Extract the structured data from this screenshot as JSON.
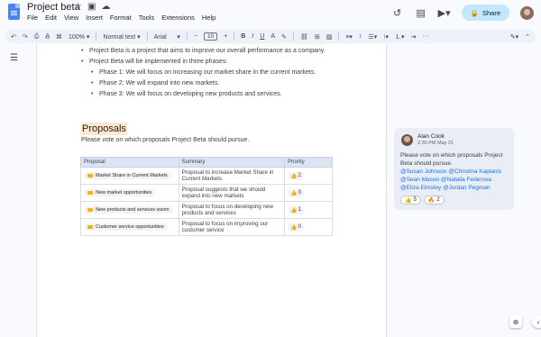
{
  "app": {
    "title": "Project beta",
    "menu": [
      "File",
      "Edit",
      "View",
      "Insert",
      "Format",
      "Tools",
      "Extensions",
      "Help"
    ],
    "share_label": "Share"
  },
  "toolbar": {
    "zoom": "100%",
    "style": "Normal text",
    "font": "Arial",
    "font_size": "10",
    "more": "···"
  },
  "document": {
    "bullets": [
      "Project Beta is a project that aims to improve our overall performance as a company.",
      "Project Beta will be implemented in three phases:"
    ],
    "sub_bullets": [
      "Phase 1: We will focus on increasing our market share in the current markets.",
      "Phase 2: We will expand into new markets.",
      "Phase 3: We will focus on developing new products and services."
    ],
    "heading": "Proposals",
    "subtitle": "Please vote on which proposals Project Beta should pursue.",
    "table": {
      "headers": [
        "Proposal",
        "Summary",
        "Priority"
      ],
      "rows": [
        {
          "proposal": "Market Share in Current Markets",
          "summary": "Proposal to increase Market Share in Current Markets",
          "priority": "2"
        },
        {
          "proposal": "New market opportunities",
          "summary": "Proposal suggests that we should expand into new markets",
          "priority": "0"
        },
        {
          "proposal": "New products and services vision",
          "summary": "Proposal to focus on developing new products and services",
          "priority": "1"
        },
        {
          "proposal": "Customer service opportunities",
          "summary": "Proposal to focus on improving our customer service",
          "priority": "0"
        }
      ]
    }
  },
  "comment": {
    "author": "Alan Cook",
    "time": "2:30 PM May 21",
    "text": "Please vote on which proposals Project Beta should pursue.",
    "mentions": [
      "@Susan Johnson",
      "@Christina Kaplanis",
      "@Sean Mason",
      "@Natalia Federova",
      "@Eliza Elmsley",
      "@Jordan Pegman"
    ],
    "reactions": [
      {
        "emoji": "👍",
        "count": "5"
      },
      {
        "emoji": "🔥",
        "count": "2"
      }
    ]
  },
  "colors": {
    "share_bg": "#c2e7ff",
    "toolbar_bg": "#edf2fa",
    "heading_highlight": "#fce8cc",
    "table_header_bg": "#dbe5f4",
    "comment_bg": "#e9eef6",
    "mention": "#1a73e8"
  },
  "icons": [
    "star-icon",
    "folder-move-icon",
    "cloud-icon",
    "history-icon",
    "comment-icon",
    "meet-icon",
    "lock-icon",
    "undo-icon",
    "redo-icon",
    "print-icon",
    "spellcheck-icon",
    "paint-format-icon",
    "bold-icon",
    "italic-icon",
    "underline-icon",
    "text-color-icon",
    "highlight-icon",
    "link-icon",
    "add-comment-icon",
    "image-icon",
    "align-icon",
    "line-spacing-icon",
    "checklist-icon",
    "bulleted-list-icon",
    "numbered-list-icon",
    "indent-icon",
    "pencil-icon",
    "outline-icon",
    "thumbs-up-icon"
  ]
}
